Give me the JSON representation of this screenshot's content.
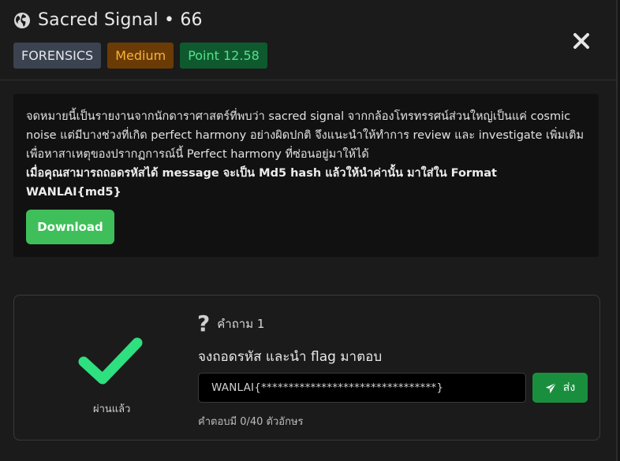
{
  "header": {
    "title": "Sacred Signal • 66",
    "tags": {
      "category": "FORENSICS",
      "difficulty": "Medium",
      "points": "Point 12.58"
    }
  },
  "description": {
    "lines": [
      "จดหมายนี้เป็นรายงานจากนักดาราศาสตร์ที่พบว่า sacred signal จากกล้องโทรทรรศน์ส่วนใหญ่เป็นแค่ cosmic",
      "noise แต่มีบางช่วงที่เกิด perfect harmony อย่างผิดปกติ จึงแนะนำให้ทำการ review และ investigate เพิ่มเติม",
      "เพื่อหาสาเหตุของปรากฏการณ์นี้ Perfect harmony ที่ซ่อนอยู่มาให้ได้"
    ],
    "bold_line": "เมื่อคุณสามารถถอดรหัสได้ message จะเป็น Md5 hash แล้วให้นำค่านั้น มาใส่ใน Format WANLAI{md5}",
    "download_label": "Download"
  },
  "question": {
    "status_label": "ผ่านแล้ว",
    "number_label": "คำถาม 1",
    "text": "จงถอดรหัส และนำ flag มาตอบ",
    "answer_value": "WANLAI{********************************}",
    "send_label": "ส่ง",
    "counter": "คำตอบมี  0/40  ตัวอักษร"
  },
  "colors": {
    "download": "#3fbf5a",
    "send": "#198f3e",
    "check": "#2ee07f",
    "difficulty_bg": "#6b3b05",
    "points_bg": "#0e5a2e"
  },
  "icons": {
    "title": "globe-icon",
    "close": "close-icon",
    "passed": "checkmark-icon",
    "question": "question-mark-icon",
    "send": "paper-plane-icon"
  }
}
